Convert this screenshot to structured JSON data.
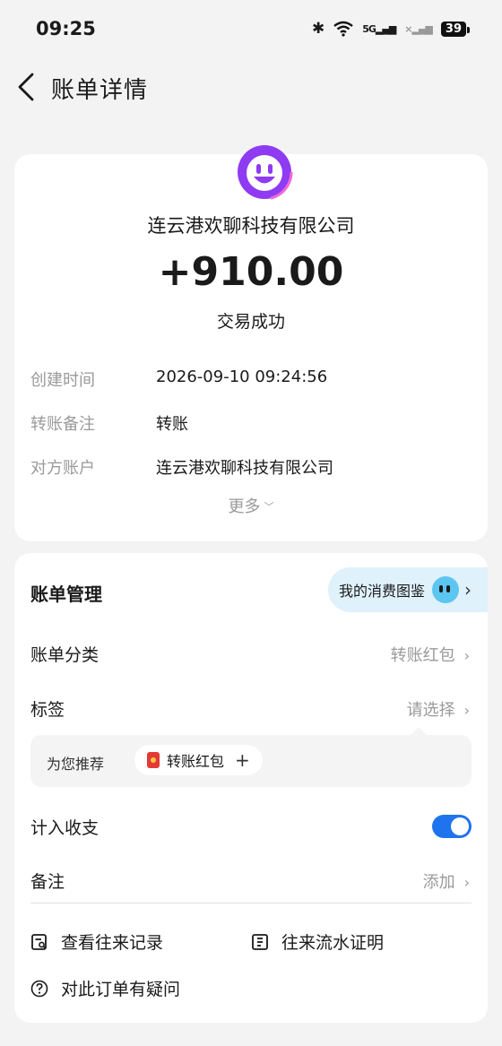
{
  "status_bar": {
    "time": "09:25",
    "sig1": "5G",
    "sig2": "×",
    "battery": "39"
  },
  "nav": {
    "title": "账单详情"
  },
  "transaction": {
    "merchant": "连云港欢聊科技有限公司",
    "amount": "+910.00",
    "status": "交易成功",
    "details": [
      {
        "label": "创建时间",
        "value": "2026-09-10 09:24:56"
      },
      {
        "label": "转账备注",
        "value": "转账"
      },
      {
        "label": "对方账户",
        "value": "连云港欢聊科技有限公司"
      }
    ],
    "more_label": "更多"
  },
  "management": {
    "title": "账单管理",
    "badge_label": "我的消费图鉴",
    "category": {
      "label": "账单分类",
      "value": "转账红包"
    },
    "tag": {
      "label": "标签",
      "value": "请选择"
    },
    "recommend": {
      "label": "为您推荐",
      "chip": "转账红包"
    },
    "include": {
      "label": "计入收支",
      "enabled": true
    },
    "remark": {
      "label": "备注",
      "value": "添加"
    },
    "links": {
      "history": "查看往来记录",
      "proof": "往来流水证明",
      "question": "对此订单有疑问"
    }
  },
  "colors": {
    "accent": "#1f74ee",
    "logo_purple": "#8e3bf2",
    "badge_bg": "#dff1fb"
  }
}
